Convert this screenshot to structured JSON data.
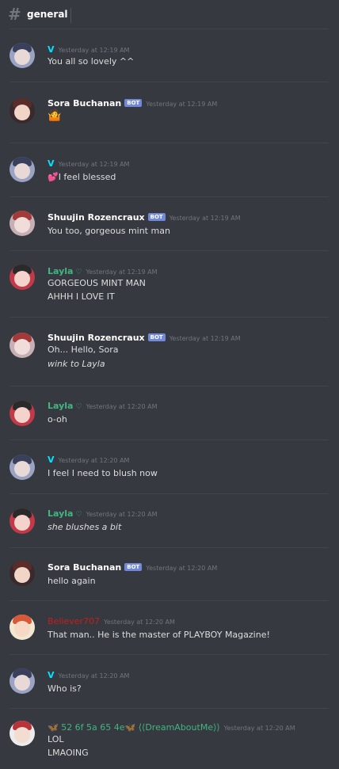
{
  "channel": {
    "icon": "hash-icon",
    "name": "general"
  },
  "colors": {
    "background": "#36393f",
    "v": "#00e5ff",
    "white": "#ffffff",
    "layla": "#43b581",
    "believer": "#c21f1f",
    "bot_badge": "#7289da"
  },
  "messages": [
    {
      "author": "V",
      "bot": false,
      "timestamp": "Yesterday at 12:19 AM",
      "lines": [
        "You all so lovely ^^"
      ]
    },
    {
      "author": "Sora Buchanan",
      "bot": true,
      "bot_label": "BOT",
      "timestamp": "Yesterday at 12:19 AM",
      "lines": [
        "🤷"
      ]
    },
    {
      "author": "V",
      "bot": false,
      "timestamp": "Yesterday at 12:19 AM",
      "lines": [
        "💕I feel blessed"
      ]
    },
    {
      "author": "Shuujin Rozencraux",
      "bot": true,
      "bot_label": "BOT",
      "timestamp": "Yesterday at 12:19 AM",
      "lines": [
        "You too, gorgeous mint man"
      ]
    },
    {
      "author": "Layla",
      "heart": "♡",
      "bot": false,
      "timestamp": "Yesterday at 12:19 AM",
      "lines": [
        "GORGEOUS MINT MAN",
        "AHHH I LOVE IT"
      ]
    },
    {
      "author": "Shuujin Rozencraux",
      "bot": true,
      "bot_label": "BOT",
      "timestamp": "Yesterday at 12:19 AM",
      "lines": [
        "Oh... Hello, Sora",
        "wink to Layla"
      ]
    },
    {
      "author": "Layla",
      "heart": "♡",
      "bot": false,
      "timestamp": "Yesterday at 12:20 AM",
      "lines": [
        "o-oh"
      ]
    },
    {
      "author": "V",
      "bot": false,
      "timestamp": "Yesterday at 12:20 AM",
      "lines": [
        "I feel I need to blush now"
      ]
    },
    {
      "author": "Layla",
      "heart": "♡",
      "bot": false,
      "timestamp": "Yesterday at 12:20 AM",
      "lines": [
        "she blushes a bit"
      ]
    },
    {
      "author": "Sora Buchanan",
      "bot": true,
      "bot_label": "BOT",
      "timestamp": "Yesterday at 12:20 AM",
      "lines": [
        "hello again"
      ]
    },
    {
      "author": "Believer707",
      "bot": false,
      "timestamp": "Yesterday at 12:20 AM",
      "lines": [
        "That man.. He is the master of PLAYBOY Magazine!"
      ]
    },
    {
      "author": "V",
      "bot": false,
      "timestamp": "Yesterday at 12:20 AM",
      "lines": [
        "Who is?"
      ]
    },
    {
      "author": "🦋 52 6f 5a 65 4e🦋 ⟨⟨DreamAboutMe⟩⟩",
      "bot": false,
      "timestamp": "Yesterday at 12:20 AM",
      "lines": [
        "LOL",
        "LMAOING"
      ]
    }
  ]
}
